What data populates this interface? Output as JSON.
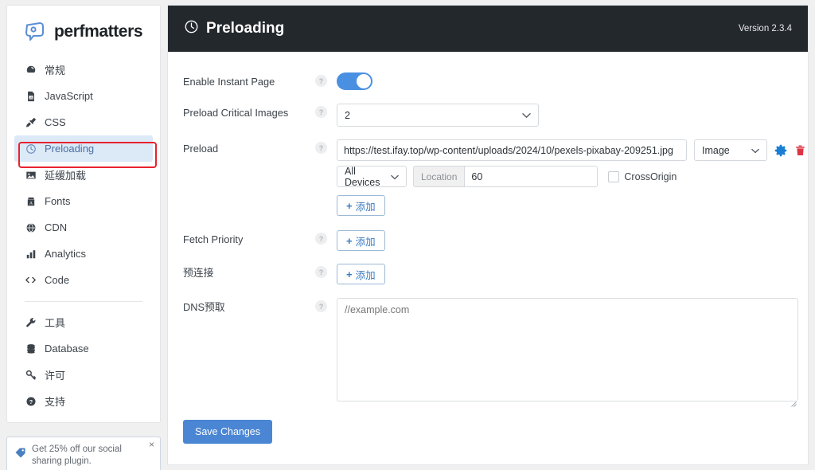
{
  "sidebar": {
    "logo_text": "perfmatters",
    "items": [
      {
        "label": "常规",
        "icon": "gauge-icon",
        "active": false
      },
      {
        "label": "JavaScript",
        "icon": "file-js-icon",
        "active": false
      },
      {
        "label": "CSS",
        "icon": "brush-icon",
        "active": false
      },
      {
        "label": "Preloading",
        "icon": "clock-icon",
        "active": true
      },
      {
        "label": "延缓加载",
        "icon": "image-icon",
        "active": false
      },
      {
        "label": "Fonts",
        "icon": "font-icon",
        "active": false
      },
      {
        "label": "CDN",
        "icon": "globe-icon",
        "active": false
      },
      {
        "label": "Analytics",
        "icon": "bar-chart-icon",
        "active": false
      },
      {
        "label": "Code",
        "icon": "code-icon",
        "active": false
      }
    ],
    "items_secondary": [
      {
        "label": "工具",
        "icon": "wrench-icon"
      },
      {
        "label": "Database",
        "icon": "database-icon"
      },
      {
        "label": "许可",
        "icon": "key-icon"
      },
      {
        "label": "支持",
        "icon": "question-circle-icon"
      }
    ]
  },
  "promo": {
    "text": "Get 25% off our social sharing plugin.",
    "close_label": "×",
    "icon": "tag-icon"
  },
  "header": {
    "title": "Preloading",
    "icon": "clock-icon",
    "version": "Version 2.3.4"
  },
  "form": {
    "help_glyph": "?",
    "rows": {
      "instant_page": {
        "label": "Enable Instant Page",
        "toggle_on": true
      },
      "critical_images": {
        "label": "Preload Critical Images",
        "value": "2"
      },
      "preload": {
        "label": "Preload",
        "url_value": "https://test.ifay.top/wp-content/uploads/2024/10/pexels-pixabay-209251.jpg",
        "type_value": "Image",
        "device_value": "All Devices",
        "location_label": "Location",
        "location_value": "60",
        "crossorigin_label": "CrossOrigin",
        "crossorigin_checked": false,
        "settings_icon": "gear-icon",
        "delete_icon": "trash-icon",
        "add_label": "添加"
      },
      "fetch_priority": {
        "label": "Fetch Priority",
        "add_label": "添加"
      },
      "preconnect": {
        "label": "预连接",
        "add_label": "添加"
      },
      "dns_prefetch": {
        "label": "DNS预取",
        "placeholder": "//example.com",
        "value": ""
      }
    },
    "save_label": "Save Changes"
  },
  "colors": {
    "header_bg": "#23282d",
    "accent_blue": "#4a86d4",
    "toggle_blue": "#4a90e2",
    "gear_blue": "#1a7fd4",
    "trash_red": "#dc3545",
    "highlight_red": "#e8232e",
    "active_nav_bg": "#dce9f7"
  }
}
